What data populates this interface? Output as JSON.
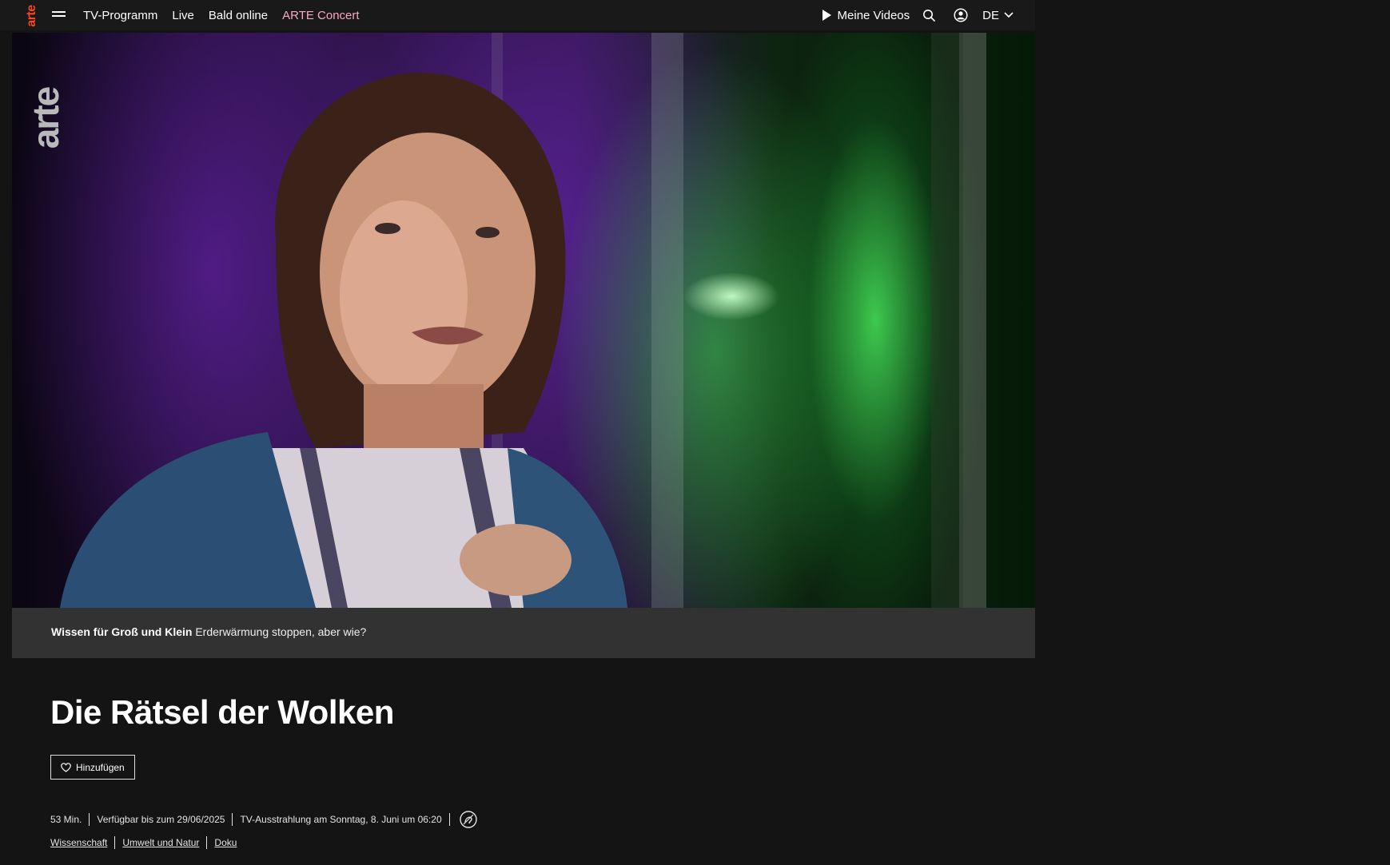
{
  "header": {
    "logo_text": "arte",
    "nav": [
      "TV-Programm",
      "Live",
      "Bald online",
      "ARTE Concert"
    ],
    "my_videos": "Meine Videos",
    "language": "DE"
  },
  "player": {
    "watermark": "arte",
    "series": "Wissen für Groß und Klein",
    "episode": "Erderwärmung stoppen, aber wie?"
  },
  "program": {
    "title": "Die Rätsel der Wolken",
    "add_label": "Hinzufügen",
    "duration": "53 Min.",
    "availability": "Verfügbar bis zum 29/06/2025",
    "broadcast": "TV-Ausstrahlung am Sonntag, 8. Juni um 06:20",
    "tags": [
      "Wissenschaft",
      "Umwelt und Natur",
      "Doku"
    ]
  },
  "colors": {
    "background": "#141414",
    "logo": "#fa481c",
    "accent_link": "#f8a8c4",
    "caption_bar": "#323232"
  },
  "icons": [
    "menu-icon",
    "play-icon",
    "search-icon",
    "user-icon",
    "chevron-down-icon",
    "heart-icon",
    "audio-description-icon"
  ]
}
